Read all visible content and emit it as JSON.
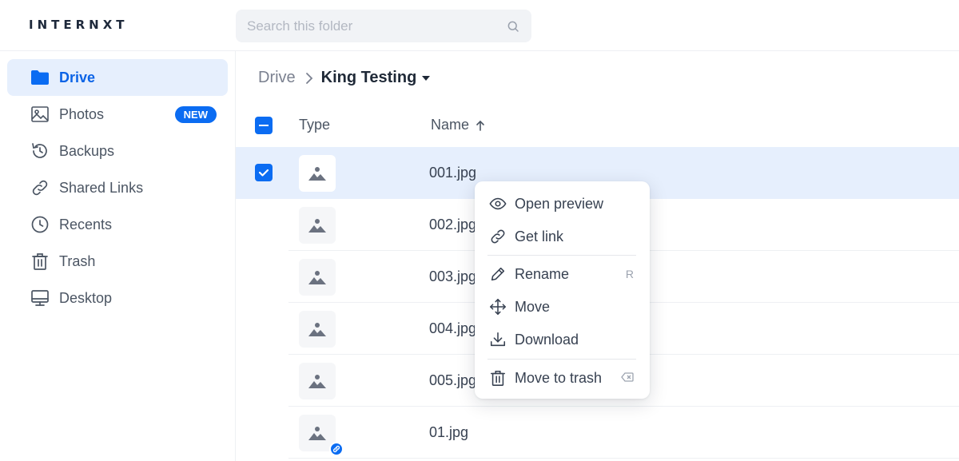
{
  "app": {
    "logo_text": "INTERNXT",
    "accent_color": "#0b6cf2"
  },
  "search": {
    "placeholder": "Search this folder",
    "icon": "search-icon"
  },
  "sidebar": {
    "items": [
      {
        "label": "Drive",
        "icon": "folder-icon",
        "active": true
      },
      {
        "label": "Photos",
        "icon": "image-icon",
        "badge": "NEW"
      },
      {
        "label": "Backups",
        "icon": "history-icon"
      },
      {
        "label": "Shared Links",
        "icon": "link-icon"
      },
      {
        "label": "Recents",
        "icon": "clock-icon"
      },
      {
        "label": "Trash",
        "icon": "trash-icon"
      },
      {
        "label": "Desktop",
        "icon": "desktop-icon"
      }
    ]
  },
  "breadcrumb": {
    "root": "Drive",
    "current": "King Testing"
  },
  "table": {
    "columns": {
      "type": "Type",
      "name": "Name"
    },
    "sort": "ascending",
    "rows": [
      {
        "name": "001.jpg",
        "selected": true,
        "shared": false
      },
      {
        "name": "002.jpg",
        "selected": false,
        "shared": false
      },
      {
        "name": "003.jpg",
        "selected": false,
        "shared": false
      },
      {
        "name": "004.jpg",
        "selected": false,
        "shared": false
      },
      {
        "name": "005.jpg",
        "selected": false,
        "shared": false
      },
      {
        "name": "01.jpg",
        "selected": false,
        "shared": true
      }
    ]
  },
  "context_menu": {
    "items": [
      {
        "label": "Open preview",
        "icon": "eye-icon"
      },
      {
        "label": "Get link",
        "icon": "link-icon"
      },
      {
        "label": "Rename",
        "icon": "pencil-icon",
        "shortcut": "R"
      },
      {
        "label": "Move",
        "icon": "move-arrows-icon"
      },
      {
        "label": "Download",
        "icon": "download-icon"
      },
      {
        "label": "Move to trash",
        "icon": "trash-icon",
        "shortcut_icon": "backspace-icon"
      }
    ]
  }
}
